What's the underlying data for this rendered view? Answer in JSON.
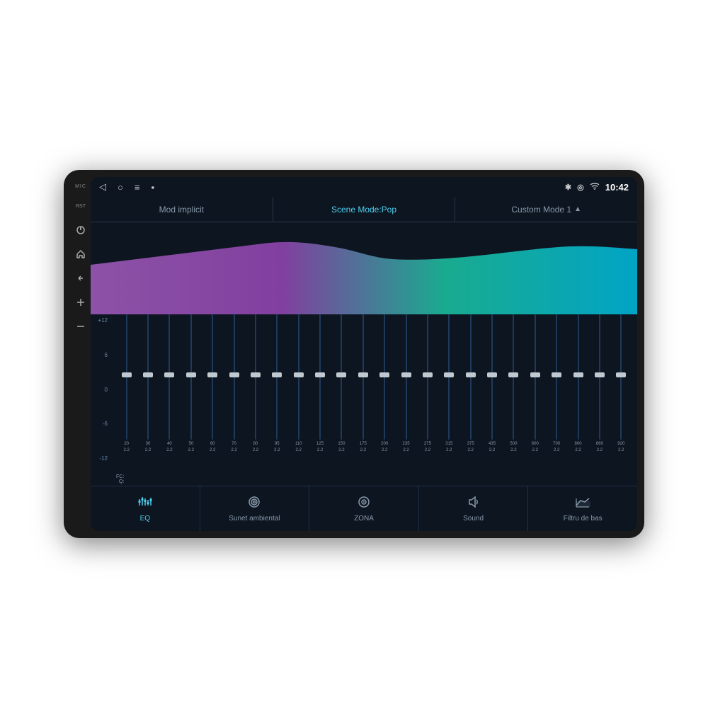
{
  "device": {
    "background": "#1a1a1a"
  },
  "status_bar": {
    "time": "10:42",
    "nav_back": "◁",
    "nav_home": "○",
    "nav_menu": "≡",
    "nav_recent": "▪",
    "bluetooth_icon": "⁎",
    "location_icon": "⊙",
    "wifi_icon": "≋"
  },
  "mode_bar": {
    "items": [
      {
        "label": "Mod implicit",
        "active": false
      },
      {
        "label": "Scene Mode:Pop",
        "active": true
      },
      {
        "label": "Custom Mode 1",
        "active": false,
        "arrow": "▲"
      }
    ]
  },
  "eq_scale": {
    "values": [
      "+12",
      "6",
      "0",
      "-6",
      "-12"
    ]
  },
  "freq_bands": [
    {
      "fc": "20",
      "q": "2.2",
      "thumb_pct": 50
    },
    {
      "fc": "30",
      "q": "2.2",
      "thumb_pct": 50
    },
    {
      "fc": "40",
      "q": "2.2",
      "thumb_pct": 50
    },
    {
      "fc": "50",
      "q": "2.2",
      "thumb_pct": 50
    },
    {
      "fc": "60",
      "q": "2.2",
      "thumb_pct": 50
    },
    {
      "fc": "70",
      "q": "2.2",
      "thumb_pct": 50
    },
    {
      "fc": "80",
      "q": "2.2",
      "thumb_pct": 50
    },
    {
      "fc": "95",
      "q": "2.2",
      "thumb_pct": 50
    },
    {
      "fc": "110",
      "q": "2.2",
      "thumb_pct": 50
    },
    {
      "fc": "125",
      "q": "2.2",
      "thumb_pct": 50
    },
    {
      "fc": "150",
      "q": "2.2",
      "thumb_pct": 50
    },
    {
      "fc": "175",
      "q": "2.2",
      "thumb_pct": 50
    },
    {
      "fc": "200",
      "q": "2.2",
      "thumb_pct": 50
    },
    {
      "fc": "235",
      "q": "2.2",
      "thumb_pct": 50
    },
    {
      "fc": "275",
      "q": "2.2",
      "thumb_pct": 50
    },
    {
      "fc": "315",
      "q": "2.2",
      "thumb_pct": 50
    },
    {
      "fc": "375",
      "q": "2.2",
      "thumb_pct": 50
    },
    {
      "fc": "435",
      "q": "2.2",
      "thumb_pct": 50
    },
    {
      "fc": "500",
      "q": "2.2",
      "thumb_pct": 50
    },
    {
      "fc": "600",
      "q": "2.2",
      "thumb_pct": 50
    },
    {
      "fc": "700",
      "q": "2.2",
      "thumb_pct": 50
    },
    {
      "fc": "800",
      "q": "2.2",
      "thumb_pct": 50
    },
    {
      "fc": "860",
      "q": "2.2",
      "thumb_pct": 50
    },
    {
      "fc": "920",
      "q": "2.2",
      "thumb_pct": 50
    }
  ],
  "bottom_nav": {
    "tabs": [
      {
        "id": "eq",
        "label": "EQ",
        "active": true,
        "icon": "eq"
      },
      {
        "id": "sunet",
        "label": "Sunet ambiental",
        "active": false,
        "icon": "sunet"
      },
      {
        "id": "zona",
        "label": "ZONA",
        "active": false,
        "icon": "zona"
      },
      {
        "id": "sound",
        "label": "Sound",
        "active": false,
        "icon": "sound"
      },
      {
        "id": "filtru",
        "label": "Filtru de bas",
        "active": false,
        "icon": "filtru"
      }
    ]
  },
  "side_labels": {
    "mic": "MIC",
    "rst": "RST"
  }
}
